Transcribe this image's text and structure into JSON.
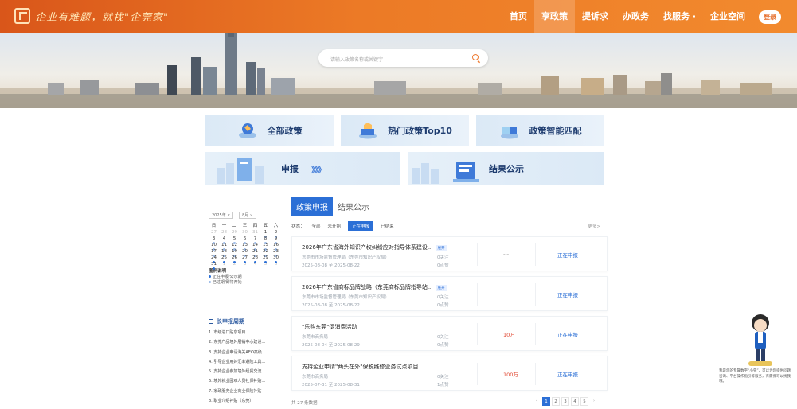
{
  "header": {
    "logo_text": "企业有难题，就找\"企莞家\"",
    "nav": [
      {
        "label": "首页",
        "active": false
      },
      {
        "label": "享政策",
        "active": true
      },
      {
        "label": "提诉求",
        "active": false
      },
      {
        "label": "办政务",
        "active": false
      },
      {
        "label": "找服务 ·",
        "active": false
      },
      {
        "label": "企业空间",
        "active": false
      }
    ],
    "login_label": "登录"
  },
  "search": {
    "placeholder": "请输入政策名称或关键字"
  },
  "cards": {
    "all_policies": "全部政策",
    "hot_policies": "热门政策Top10",
    "smart_match": "政策智能匹配",
    "apply": "申报",
    "apply_arrows": "》》》",
    "result": "结果公示"
  },
  "calendar": {
    "year": "2025年 ∨",
    "month": "8月 ∨",
    "weekdays": [
      "日",
      "一",
      "二",
      "三",
      "四",
      "五",
      "六"
    ],
    "days": [
      {
        "d": "27",
        "muted": true
      },
      {
        "d": "28",
        "muted": true
      },
      {
        "d": "29",
        "muted": true
      },
      {
        "d": "30",
        "muted": true
      },
      {
        "d": "31",
        "muted": true
      },
      {
        "d": "1",
        "muted": false
      },
      {
        "d": "2",
        "muted": false
      },
      {
        "d": "3",
        "muted": false
      },
      {
        "d": "4",
        "muted": false
      },
      {
        "d": "5",
        "muted": false
      },
      {
        "d": "6",
        "muted": false
      },
      {
        "d": "7",
        "muted": false
      },
      {
        "d": "8",
        "muted": false
      },
      {
        "d": "9",
        "muted": false
      },
      {
        "d": "10",
        "muted": false
      },
      {
        "d": "11",
        "muted": false
      },
      {
        "d": "12",
        "muted": false
      },
      {
        "d": "13",
        "muted": false
      },
      {
        "d": "14",
        "muted": false
      },
      {
        "d": "15",
        "muted": false
      },
      {
        "d": "16",
        "muted": false
      },
      {
        "d": "17",
        "muted": false
      },
      {
        "d": "18",
        "muted": false
      },
      {
        "d": "19",
        "muted": false
      },
      {
        "d": "20",
        "muted": false
      },
      {
        "d": "21",
        "muted": false
      },
      {
        "d": "22",
        "muted": false
      },
      {
        "d": "23",
        "muted": false
      },
      {
        "d": "24",
        "muted": false
      },
      {
        "d": "25",
        "muted": false
      },
      {
        "d": "26",
        "muted": false
      },
      {
        "d": "27",
        "muted": false
      },
      {
        "d": "28",
        "muted": false
      },
      {
        "d": "29",
        "muted": false
      },
      {
        "d": "30",
        "muted": false
      },
      {
        "d": "31",
        "muted": false
      },
      {
        "d": "1",
        "muted": true
      },
      {
        "d": "2",
        "muted": true
      },
      {
        "d": "3",
        "muted": true
      },
      {
        "d": "4",
        "muted": true
      },
      {
        "d": "5",
        "muted": true
      },
      {
        "d": "6",
        "muted": true
      }
    ],
    "legend_title": "图例说明",
    "legend_items": [
      "正在申报/公示期",
      "已过期/即将开始"
    ],
    "colors": {
      "active": "#2b6fd6",
      "inactive": "#9cbbe8"
    }
  },
  "longterm": {
    "title": "长申报周期",
    "items": [
      "1. 市级进口贴息项目",
      "2. 东莞产品境外展销中心建设...",
      "3. 支持企业申请海关AEO高级...",
      "4. 引导企业用好汇率避险工具...",
      "5. 支持企业参加境外经贸交流...",
      "6. 境外就业困难人员社保补贴...",
      "7. 家政服务企业商业保险补贴",
      "8. 职业介绍补贴（东莞）"
    ]
  },
  "main": {
    "tabs": [
      {
        "label": "政策申报",
        "active": true
      },
      {
        "label": "结果公示",
        "active": false
      }
    ],
    "filter_label": "状态：",
    "filters": [
      {
        "label": "全部",
        "on": false
      },
      {
        "label": "未开始",
        "on": false
      },
      {
        "label": "正在申报",
        "on": true
      },
      {
        "label": "已结束",
        "on": false
      }
    ],
    "more": "更多>",
    "policies": [
      {
        "title": "2026年广东省海外知识产权纠纷应对指导体系建设...",
        "badge": "展开",
        "org": "东莞市市场监督管理局（东莞市知识产权局）",
        "date": "2025-08-08 至 2025-08-22",
        "fav": "0关注",
        "like": "0点赞",
        "amount": "---",
        "status": "正在申报"
      },
      {
        "title": "2026年广东省商标品牌战略（东莞商标品牌指导站...",
        "badge": "展开",
        "org": "东莞市市场监督管理局（东莞市知识产权局）",
        "date": "2025-08-08 至 2025-08-22",
        "fav": "0关注",
        "like": "0点赞",
        "amount": "---",
        "status": "正在申报"
      },
      {
        "title": "\"乐购东莞\"促消费活动",
        "badge": "",
        "org": "东莞市商务局",
        "date": "2025-08-04 至 2025-08-29",
        "fav": "0关注",
        "like": "0点赞",
        "amount": "10万",
        "status": "正在申报"
      },
      {
        "title": "支持企业申请\"两头在外\"保税维修业务试点项目",
        "badge": "",
        "org": "东莞市商务局",
        "date": "2025-07-31 至 2025-08-31",
        "fav": "0关注",
        "like": "1点赞",
        "amount": "100万",
        "status": "正在申报"
      }
    ],
    "total": "共 27 条数据",
    "pages": [
      "1",
      "2",
      "3",
      "4",
      "5"
    ],
    "current_page": "1"
  },
  "assistant": {
    "text": "我是您的专属数字“小莞”，可以为您提供问题咨询、平台操作指引等服务，有需要可以找我哦。"
  }
}
